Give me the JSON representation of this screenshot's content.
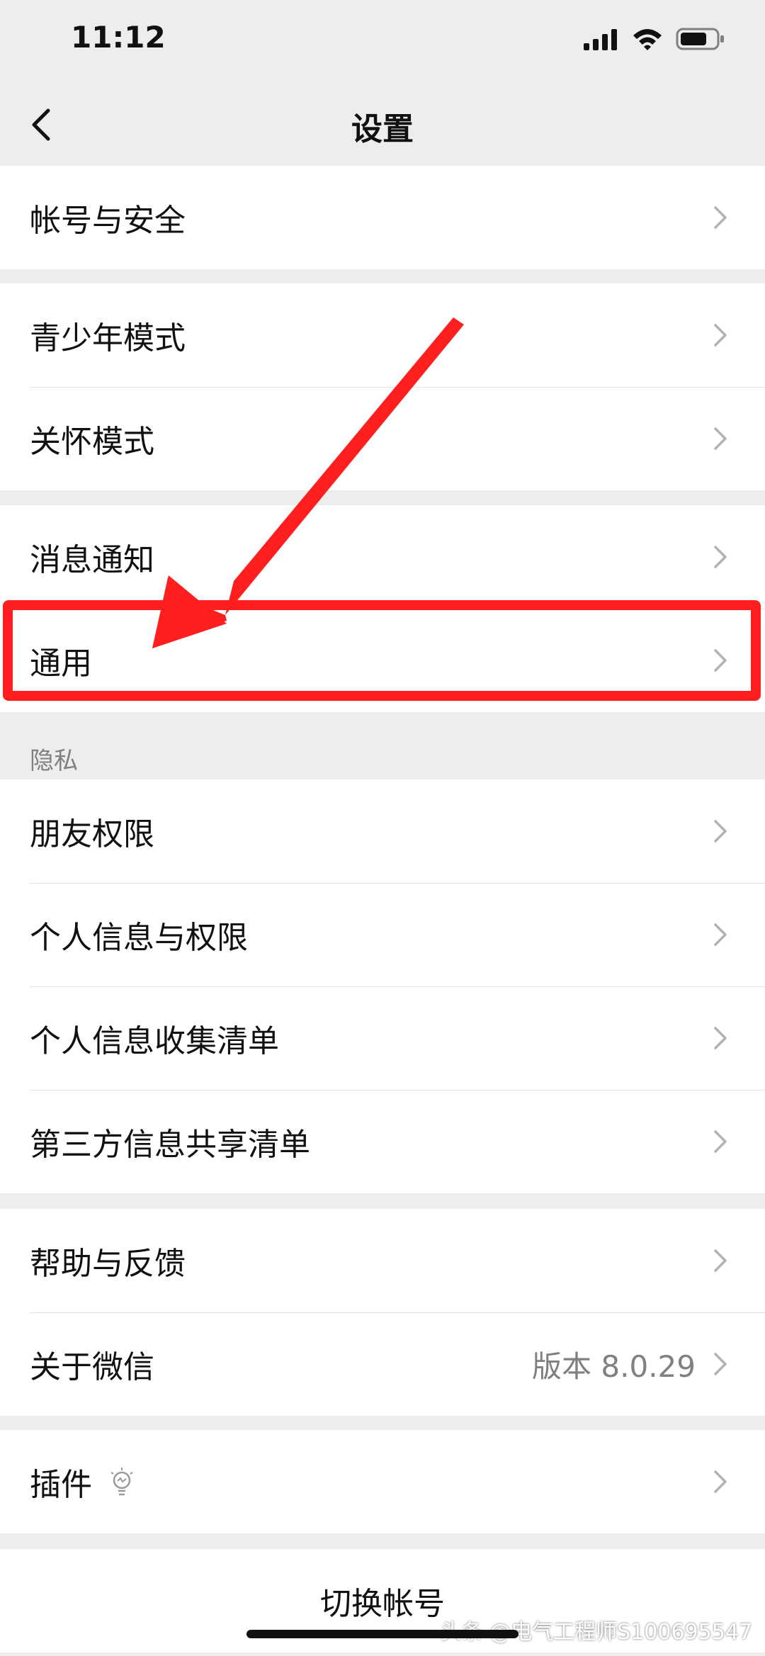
{
  "status": {
    "time": "11:12"
  },
  "nav": {
    "title": "设置"
  },
  "groups": {
    "account": [
      "帐号与安全"
    ],
    "modes": [
      "青少年模式",
      "关怀模式"
    ],
    "notify": [
      "消息通知",
      "通用"
    ],
    "privacy_title": "隐私",
    "privacy": [
      "朋友权限",
      "个人信息与权限",
      "个人信息收集清单",
      "第三方信息共享清单"
    ],
    "help": [
      "帮助与反馈",
      "关于微信"
    ],
    "about_value": "版本 8.0.29",
    "plugin": "插件",
    "switch_account": "切换帐号"
  },
  "watermark": "头条 @电气工程师S100695547",
  "colors": {
    "highlight": "#ff1f1f",
    "background": "#ededed",
    "secondary_text": "#808080"
  }
}
